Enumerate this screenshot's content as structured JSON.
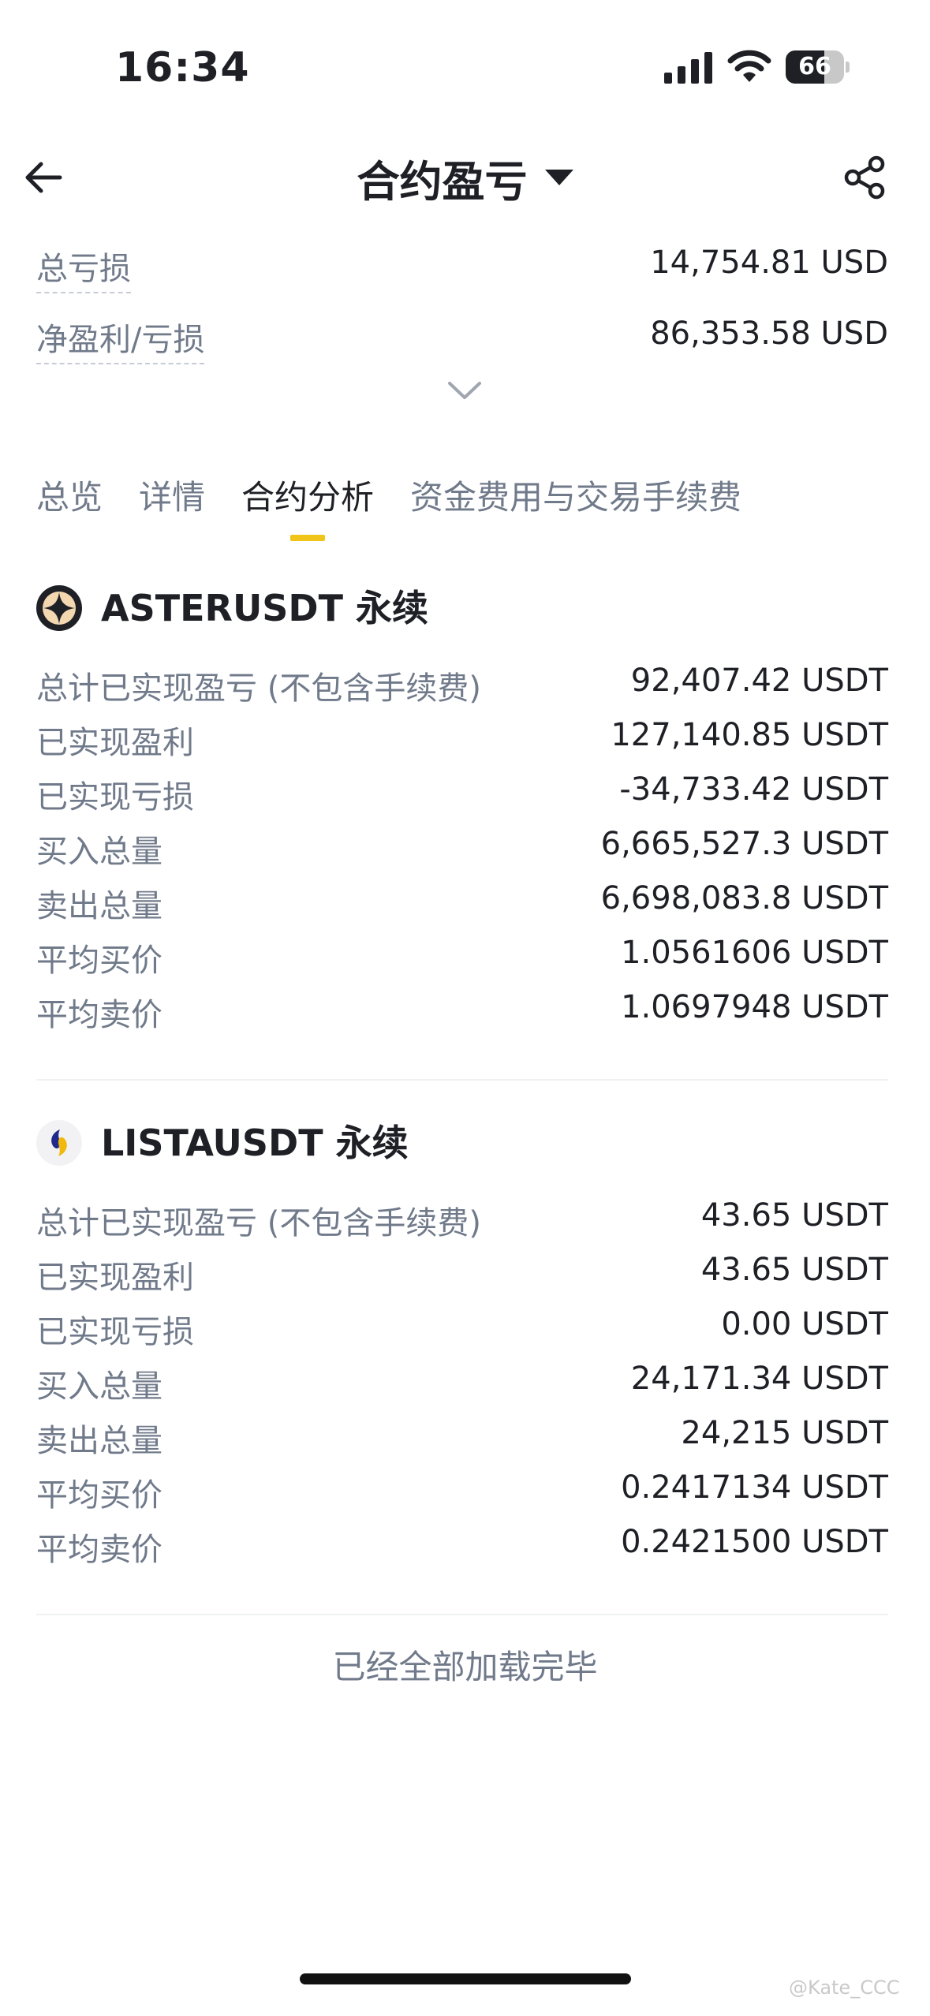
{
  "status_bar": {
    "time": "16:34",
    "battery": "66",
    "battery_level": 0.66
  },
  "header": {
    "title": "合约盈亏"
  },
  "summary": [
    {
      "label": "总亏损",
      "value": "14,754.81 USD"
    },
    {
      "label": "净盈利/亏损",
      "value": "86,353.58 USD"
    }
  ],
  "tabs": [
    {
      "label": "总览",
      "active": false
    },
    {
      "label": "详情",
      "active": false
    },
    {
      "label": "合约分析",
      "active": true
    },
    {
      "label": "资金费用与交易手续费",
      "active": false
    }
  ],
  "contracts": [
    {
      "name": "ASTERUSDT 永续",
      "icon": "aster-coin-icon",
      "stats": [
        {
          "label": "总计已实现盈亏 (不包含手续费)",
          "value": "92,407.42 USDT"
        },
        {
          "label": "已实现盈利",
          "value": "127,140.85 USDT"
        },
        {
          "label": "已实现亏损",
          "value": "-34,733.42 USDT"
        },
        {
          "label": "买入总量",
          "value": "6,665,527.3 USDT"
        },
        {
          "label": "卖出总量",
          "value": "6,698,083.8 USDT"
        },
        {
          "label": "平均买价",
          "value": "1.0561606 USDT"
        },
        {
          "label": "平均卖价",
          "value": "1.0697948 USDT"
        }
      ]
    },
    {
      "name": "LISTAUSDT 永续",
      "icon": "lista-coin-icon",
      "stats": [
        {
          "label": "总计已实现盈亏 (不包含手续费)",
          "value": "43.65 USDT"
        },
        {
          "label": "已实现盈利",
          "value": "43.65 USDT"
        },
        {
          "label": "已实现亏损",
          "value": "0.00 USDT"
        },
        {
          "label": "买入总量",
          "value": "24,171.34 USDT"
        },
        {
          "label": "卖出总量",
          "value": "24,215 USDT"
        },
        {
          "label": "平均买价",
          "value": "0.2417134 USDT"
        },
        {
          "label": "平均卖价",
          "value": "0.2421500 USDT"
        }
      ]
    }
  ],
  "footer": {
    "loaded_text": "已经全部加载完毕"
  },
  "watermark": "@Kate_CCC",
  "colors": {
    "accent": "#f0c419",
    "text_primary": "#1e2026",
    "text_secondary": "#707a8a"
  }
}
